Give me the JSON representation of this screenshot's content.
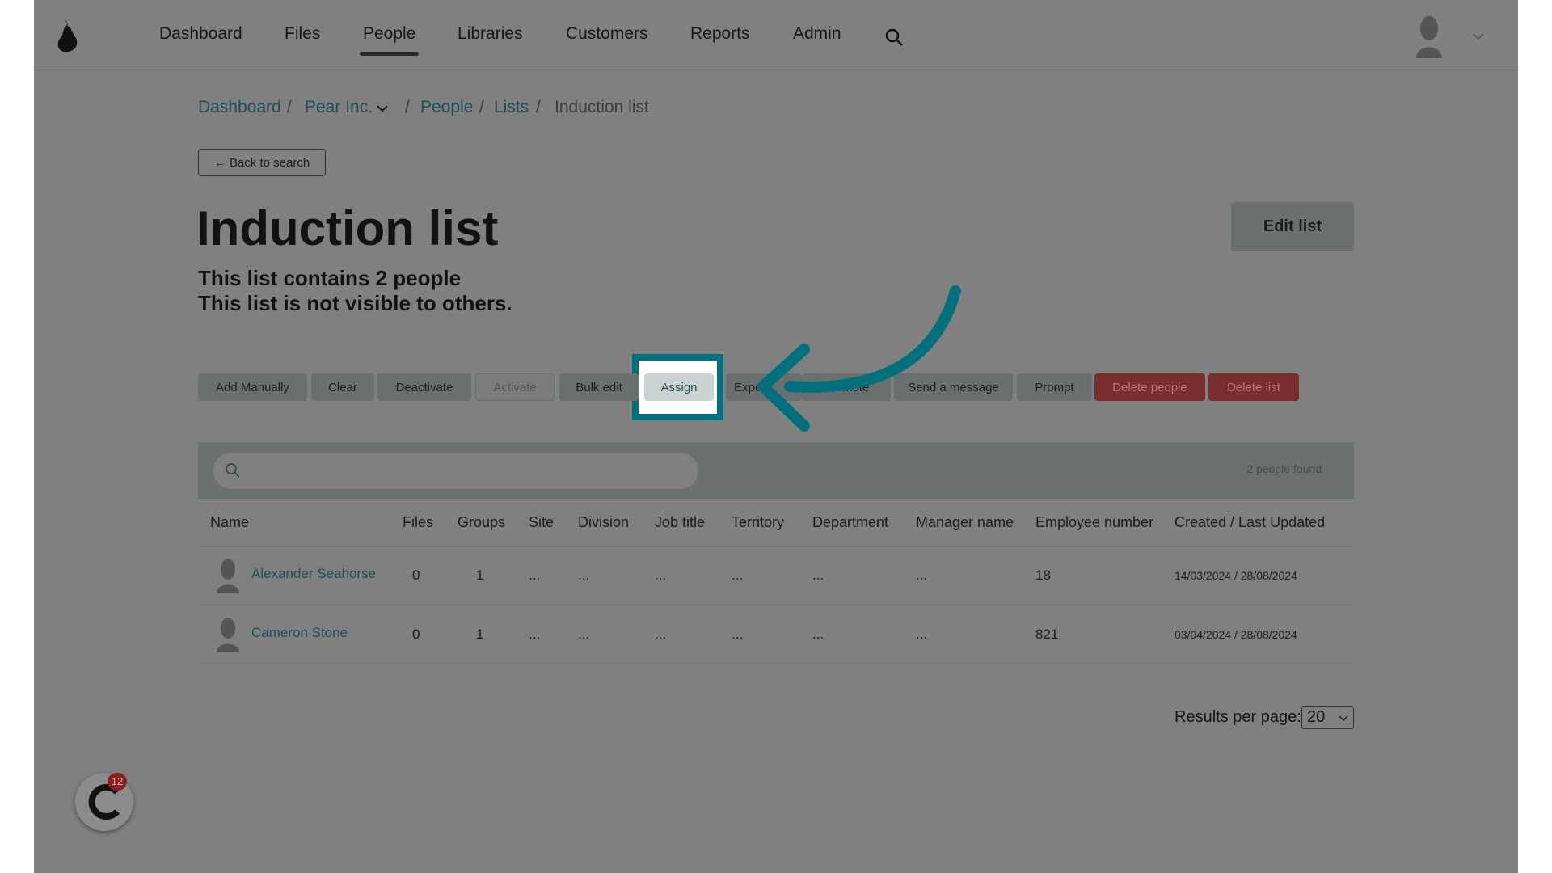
{
  "nav": {
    "items": [
      "Dashboard",
      "Files",
      "People",
      "Libraries",
      "Customers",
      "Reports",
      "Admin"
    ],
    "active": "People"
  },
  "breadcrumb": {
    "dashboard": "Dashboard",
    "org": "Pear Inc.",
    "people": "People",
    "lists": "Lists",
    "current": "Induction list",
    "separator": "/"
  },
  "back_button": "← Back to search",
  "title": "Induction list",
  "edit_button": "Edit list",
  "info": {
    "count": "This list contains 2 people",
    "visibility": "This list is not visible to others."
  },
  "actions": [
    "Add Manually",
    "Clear",
    "Deactivate",
    "Activate",
    "Bulk edit",
    "Assign",
    "Export",
    "Promote",
    "Send a message",
    "Prompt",
    "Delete people",
    "Delete list"
  ],
  "highlighted_action": "Assign",
  "search": {
    "placeholder": "",
    "results": "2 people found"
  },
  "table": {
    "headers": [
      "Name",
      "Files",
      "Groups",
      "Site",
      "Division",
      "Job title",
      "Territory",
      "Department",
      "Manager name",
      "Employee number",
      "Created / Last Updated"
    ],
    "rows": [
      {
        "name": "Alexander Seahorse",
        "files": "0",
        "groups": "1",
        "site": "...",
        "division": "...",
        "job": "...",
        "territory": "...",
        "department": "...",
        "manager": "...",
        "employee": "18",
        "dates": "14/03/2024 / 28/08/2024"
      },
      {
        "name": "Cameron Stone",
        "files": "0",
        "groups": "1",
        "site": "...",
        "division": "...",
        "job": "...",
        "territory": "...",
        "department": "...",
        "manager": "...",
        "employee": "821",
        "dates": "03/04/2024 / 28/08/2024"
      }
    ]
  },
  "pagination": {
    "label": "Results per page:",
    "value": "20"
  },
  "chat_widget": {
    "badge": "12"
  },
  "colors": {
    "accent": "#00717c",
    "danger": "#7a2d2d",
    "link": "#1e4f55"
  }
}
